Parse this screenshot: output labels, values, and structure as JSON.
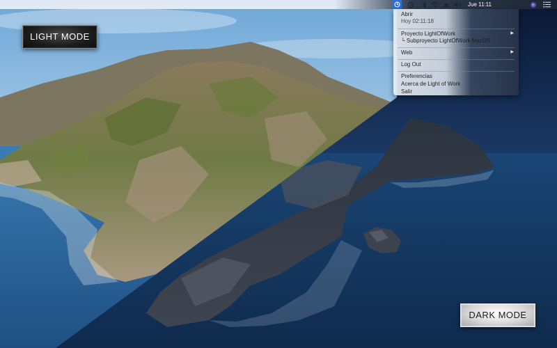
{
  "menubar": {
    "clock": "Jue 11:11",
    "icons": [
      "light-of-work-app-icon",
      "history-icon",
      "bluetooth-icon",
      "wifi-icon",
      "eject-icon",
      "volume-icon",
      "siri-icon",
      "notification-list-icon"
    ]
  },
  "menu": {
    "open_label": "Abrir",
    "today_label": "Hoy 02:11:18",
    "project_label": "Proyecto LightOfWork",
    "subproject_label": "└ Subproyecto LightOfWork MacOS",
    "web_label": "Web",
    "logout_label": "Log Out",
    "preferences_label": "Preferencias",
    "about_label": "Acerca de Light of Work",
    "quit_label": "Salir",
    "submenu_arrow": "▶"
  },
  "labels": {
    "light_mode": "LIGHT MODE",
    "dark_mode": "DARK MODE"
  },
  "colors": {
    "app_icon_bg": "#2f6fd6",
    "sky_light": "#7fb2dc",
    "sea_light": "#2e6fa6",
    "sky_dark": "#0e1f3a",
    "sea_dark": "#163a66"
  }
}
